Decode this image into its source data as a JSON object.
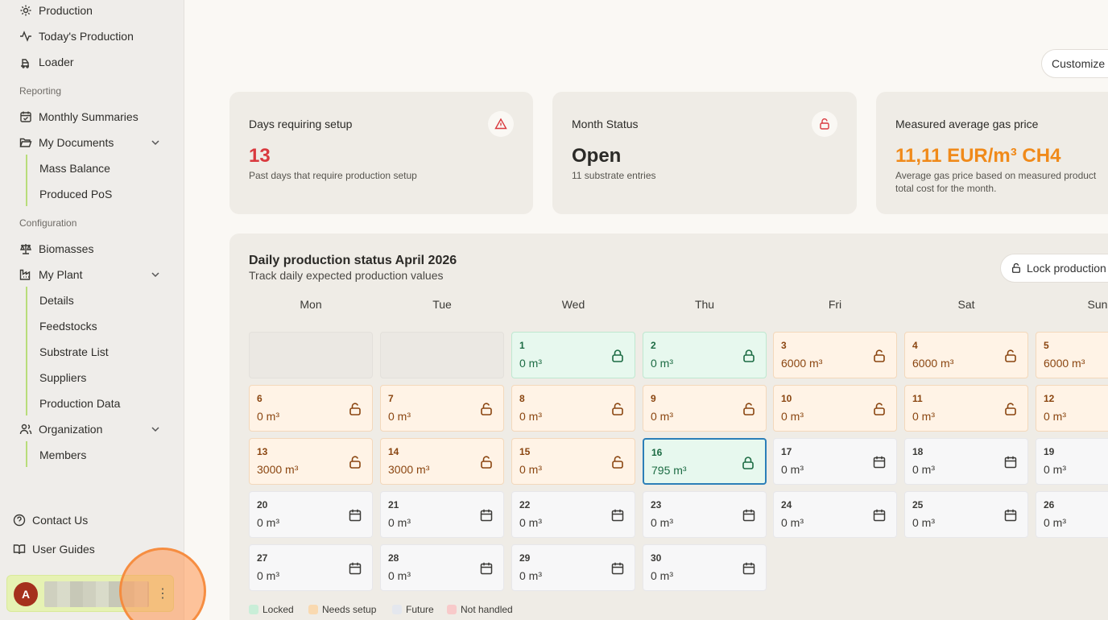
{
  "sidebar": {
    "top_items": [
      {
        "label": "Production",
        "icon": "gear-icon"
      },
      {
        "label": "Today's Production",
        "icon": "activity-icon"
      },
      {
        "label": "Loader",
        "icon": "loader-icon"
      }
    ],
    "reporting_label": "Reporting",
    "reporting_items": [
      {
        "label": "Monthly Summaries",
        "icon": "calendar-check-icon"
      },
      {
        "label": "My Documents",
        "icon": "folder-open-icon"
      }
    ],
    "documents_sub": [
      "Mass Balance",
      "Produced PoS"
    ],
    "config_label": "Configuration",
    "config_items": [
      {
        "label": "Biomasses",
        "icon": "scale-icon"
      },
      {
        "label": "My Plant",
        "icon": "factory-icon"
      }
    ],
    "plant_sub": [
      "Details",
      "Feedstocks",
      "Substrate List",
      "Suppliers",
      "Production Data"
    ],
    "org_item": {
      "label": "Organization",
      "icon": "users-icon"
    },
    "org_sub": [
      "Members"
    ],
    "contact_label": "Contact Us",
    "guides_label": "User Guides",
    "user_initial": "A"
  },
  "header": {
    "customize_label": "Customize"
  },
  "stats": [
    {
      "title": "Days requiring setup",
      "value": "13",
      "sub": "Past days that require production setup",
      "color": "#d9393e",
      "icon": "warning-icon"
    },
    {
      "title": "Month Status",
      "value": "Open",
      "sub": "11 substrate entries",
      "color": "#2b2a27",
      "icon": "unlock-icon"
    },
    {
      "title": "Measured average gas price",
      "value": "11,11 EUR/m³ CH4",
      "sub1": "Average gas price based on measured product",
      "sub2": "total cost for the month.",
      "color": "#f08a1a"
    }
  ],
  "calendar": {
    "title": "Daily production status April 2026",
    "subtitle": "Track daily expected production values",
    "lock_label": "Lock production",
    "weekdays": [
      "Mon",
      "Tue",
      "Wed",
      "Thu",
      "Fri",
      "Sat",
      "Sun"
    ],
    "days": [
      {
        "num": "1",
        "val": "0 m³",
        "status": "locked"
      },
      {
        "num": "2",
        "val": "0 m³",
        "status": "locked"
      },
      {
        "num": "3",
        "val": "6000 m³",
        "status": "needs"
      },
      {
        "num": "4",
        "val": "6000 m³",
        "status": "needs"
      },
      {
        "num": "5",
        "val": "6000 m³",
        "status": "needs"
      },
      {
        "num": "6",
        "val": "0 m³",
        "status": "needs"
      },
      {
        "num": "7",
        "val": "0 m³",
        "status": "needs"
      },
      {
        "num": "8",
        "val": "0 m³",
        "status": "needs"
      },
      {
        "num": "9",
        "val": "0 m³",
        "status": "needs"
      },
      {
        "num": "10",
        "val": "0 m³",
        "status": "needs"
      },
      {
        "num": "11",
        "val": "0 m³",
        "status": "needs"
      },
      {
        "num": "12",
        "val": "0 m³",
        "status": "needs"
      },
      {
        "num": "13",
        "val": "3000 m³",
        "status": "needs"
      },
      {
        "num": "14",
        "val": "3000 m³",
        "status": "needs"
      },
      {
        "num": "15",
        "val": "0 m³",
        "status": "needs"
      },
      {
        "num": "16",
        "val": "795 m³",
        "status": "today"
      },
      {
        "num": "17",
        "val": "0 m³",
        "status": "future"
      },
      {
        "num": "18",
        "val": "0 m³",
        "status": "future"
      },
      {
        "num": "19",
        "val": "0 m³",
        "status": "future"
      },
      {
        "num": "20",
        "val": "0 m³",
        "status": "future"
      },
      {
        "num": "21",
        "val": "0 m³",
        "status": "future"
      },
      {
        "num": "22",
        "val": "0 m³",
        "status": "future"
      },
      {
        "num": "23",
        "val": "0 m³",
        "status": "future"
      },
      {
        "num": "24",
        "val": "0 m³",
        "status": "future"
      },
      {
        "num": "25",
        "val": "0 m³",
        "status": "future"
      },
      {
        "num": "26",
        "val": "0 m³",
        "status": "future"
      },
      {
        "num": "27",
        "val": "0 m³",
        "status": "future"
      },
      {
        "num": "28",
        "val": "0 m³",
        "status": "future"
      },
      {
        "num": "29",
        "val": "0 m³",
        "status": "future"
      },
      {
        "num": "30",
        "val": "0 m³",
        "status": "future"
      }
    ],
    "legend": [
      {
        "label": "Locked",
        "color": "#c9eed8"
      },
      {
        "label": "Needs setup",
        "color": "#f9d9b0"
      },
      {
        "label": "Future",
        "color": "#e4e7ee"
      },
      {
        "label": "Not handled",
        "color": "#f8caca"
      }
    ]
  }
}
